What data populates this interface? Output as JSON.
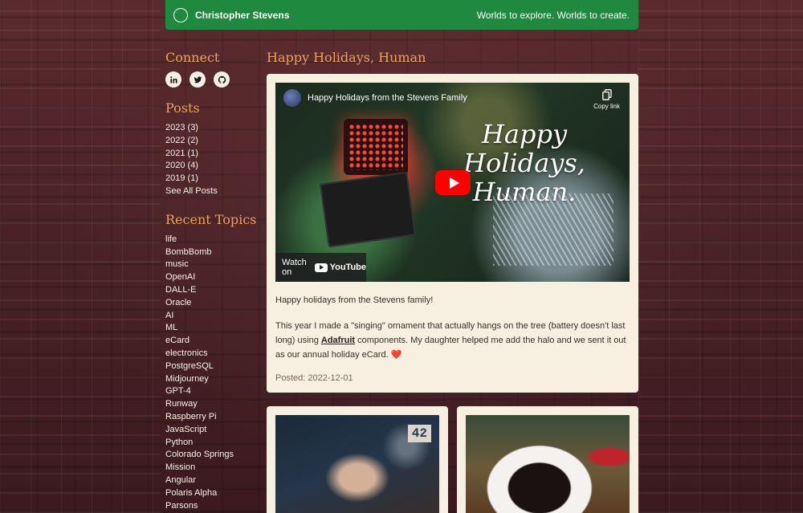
{
  "header": {
    "name": "Christopher Stevens",
    "tagline": "Worlds to explore. Worlds to create."
  },
  "sidebar": {
    "connect_heading": "Connect",
    "social": [
      {
        "icon": "linkedin-icon",
        "label": "in"
      },
      {
        "icon": "twitter-icon"
      },
      {
        "icon": "github-icon"
      }
    ],
    "posts_heading": "Posts",
    "posts": [
      {
        "label": "2023 (3)"
      },
      {
        "label": "2022 (2)"
      },
      {
        "label": "2021 (1)"
      },
      {
        "label": "2020 (4)"
      },
      {
        "label": "2019 (1)"
      },
      {
        "label": "See All Posts"
      }
    ],
    "topics_heading": "Recent Topics",
    "topics": [
      "life",
      "BombBomb",
      "music",
      "OpenAI",
      "DALL-E",
      "Oracle",
      "AI",
      "ML",
      "eCard",
      "electronics",
      "PostgreSQL",
      "Midjourney",
      "GPT-4",
      "Runway",
      "Raspberry Pi",
      "JavaScript",
      "Python",
      "Colorado Springs",
      "Mission",
      "Angular",
      "Polaris Alpha",
      "Parsons"
    ]
  },
  "post": {
    "title": "Happy Holidays, Human",
    "video": {
      "title": "Happy Holidays from the Stevens Family",
      "copy_link": "Copy link",
      "overlay_text": "Happy Holidays, Human.",
      "watch_on": "Watch on",
      "youtube": "YouTube"
    },
    "p1": "Happy holidays from the Stevens family!",
    "p2_before": "This year I made a \"singing\" ornament that actually hangs on the tree (battery doesn't last long) using ",
    "p2_link": "Adafruit",
    "p2_after": " components. My daughter helped me add the halo and we sent it out as our annual holiday eCard. ",
    "p2_heart": "❤️",
    "posted": "Posted: 2022-12-01"
  },
  "thumbnails": [
    {
      "number_label": "42"
    },
    {}
  ],
  "colors": {
    "header_green": "#1f8a3f",
    "heading_orange": "#e9a35a",
    "card_bg": "#f7f0e1"
  }
}
